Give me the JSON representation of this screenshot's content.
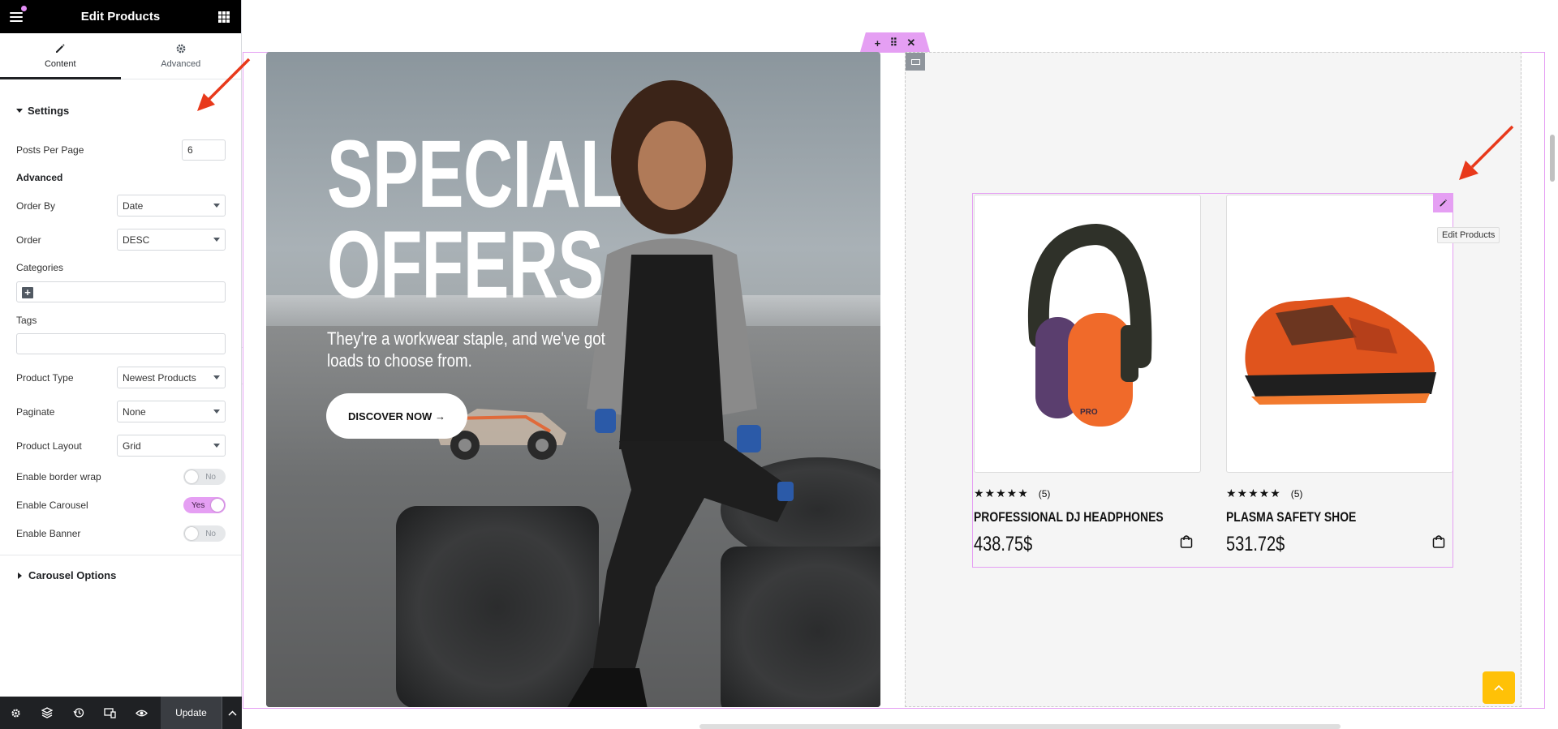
{
  "panel": {
    "title": "Edit Products",
    "tabs": [
      {
        "label": "Content",
        "icon": "pencil-icon",
        "active": true
      },
      {
        "label": "Advanced",
        "icon": "gear-icon",
        "active": false
      }
    ],
    "settings_title": "Settings",
    "posts_per_page": {
      "label": "Posts Per Page",
      "value": "6"
    },
    "advanced_heading": "Advanced",
    "order_by": {
      "label": "Order By",
      "value": "Date"
    },
    "order": {
      "label": "Order",
      "value": "DESC"
    },
    "categories_label": "Categories",
    "tags_label": "Tags",
    "product_type": {
      "label": "Product Type",
      "value": "Newest Products"
    },
    "paginate": {
      "label": "Paginate",
      "value": "None"
    },
    "product_layout": {
      "label": "Product Layout",
      "value": "Grid"
    },
    "border_wrap": {
      "label": "Enable border wrap",
      "state": "No"
    },
    "carousel": {
      "label": "Enable Carousel",
      "state": "Yes"
    },
    "banner": {
      "label": "Enable Banner",
      "state": "No"
    },
    "carousel_options": "Carousel Options",
    "update_label": "Update"
  },
  "hero": {
    "title_line1": "SPECIAL",
    "title_line2": "OFFERS",
    "subtitle": "They're a workwear staple, and we've got loads to choose from.",
    "button_label": "DISCOVER NOW →"
  },
  "widget_tooltip": "Edit Products",
  "products": [
    {
      "name": "PROFESSIONAL DJ HEADPHONES",
      "price": "438.75$",
      "stars": "★★★★★",
      "rating": 4.5,
      "reviews": "(5)"
    },
    {
      "name": "PLASMA SAFETY SHOE",
      "price": "531.72$",
      "stars": "★★★★★",
      "rating": 5,
      "reviews": "(5)"
    }
  ],
  "colors": {
    "accent": "#e59ff3",
    "panel_header": "#000000",
    "fab": "#ffc107",
    "arrow": "#e8391b"
  }
}
